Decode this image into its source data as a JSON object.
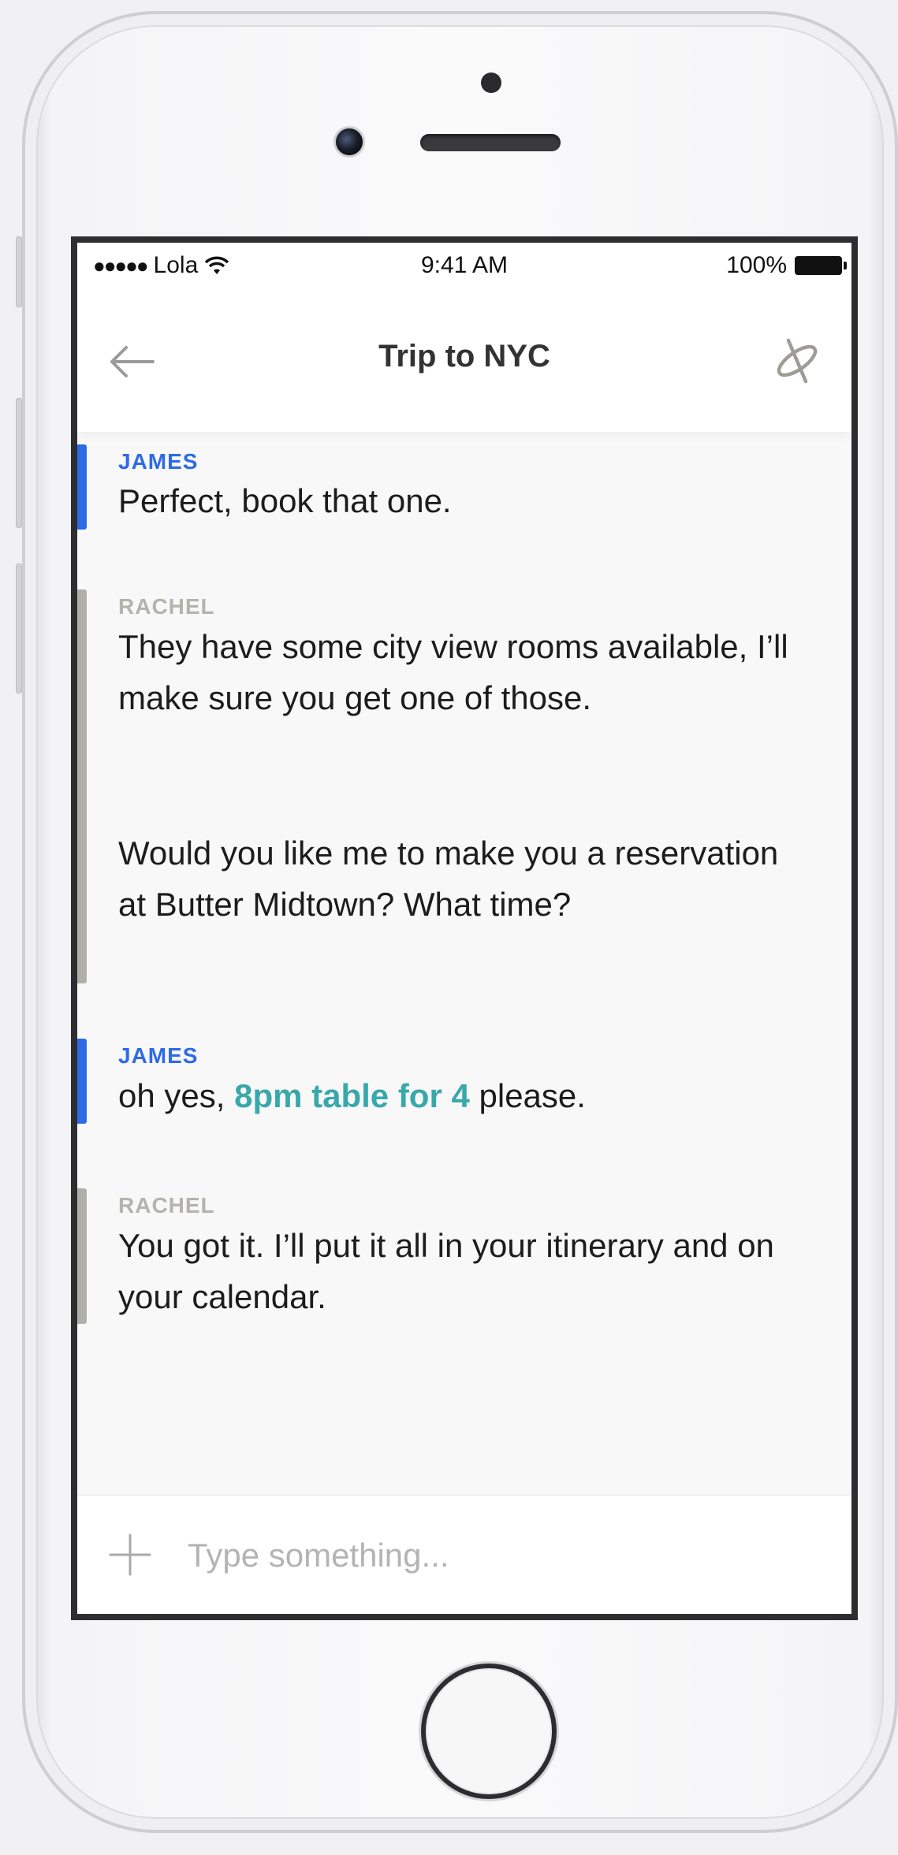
{
  "status_bar": {
    "signal_dots": "●●●●●",
    "carrier": "Lola",
    "time": "9:41 AM",
    "battery_percent": "100%",
    "wifi_icon": "wifi-icon",
    "battery_icon": "battery-icon"
  },
  "header": {
    "title": "Trip to NYC",
    "back_icon": "arrow-left-icon",
    "link_icon": "link-icon"
  },
  "messages": [
    {
      "sender": "JAMES",
      "text": "Perfect, book that one."
    },
    {
      "sender": "RACHEL",
      "paragraph_1": "They have some city view rooms available, I’ll make sure you get one of those.",
      "paragraph_2": "Would you like me to make you a reservation at Butter Midtown? What time?"
    },
    {
      "sender": "JAMES",
      "text_before": "oh yes, ",
      "highlight": "8pm table for 4",
      "text_after": " please."
    },
    {
      "sender": "RACHEL",
      "text": "You got it. I’ll put it all in your itinerary and on your calendar."
    }
  ],
  "composer": {
    "placeholder": "Type something...",
    "add_icon": "plus-icon"
  },
  "colors": {
    "james": "#2e6ae6",
    "rachel": "#b1b0a8",
    "highlight": "#3aa8ab"
  }
}
